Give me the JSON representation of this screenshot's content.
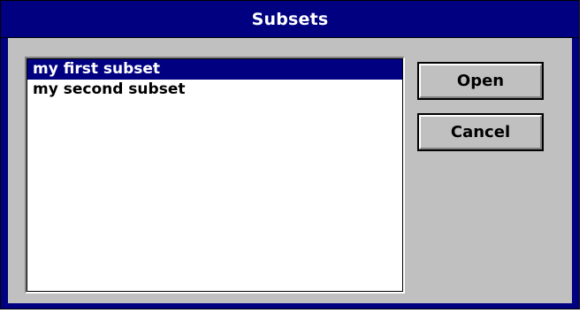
{
  "dialog": {
    "title": "Subsets"
  },
  "subsets_list": {
    "items": [
      {
        "label": "my first subset",
        "selected": true
      },
      {
        "label": "my second subset",
        "selected": false
      }
    ]
  },
  "buttons": {
    "open_label": "Open",
    "cancel_label": "Cancel"
  },
  "colors": {
    "title_bar": "#000080",
    "dialog_bg": "#c0c0c0",
    "selection": "#000080"
  }
}
